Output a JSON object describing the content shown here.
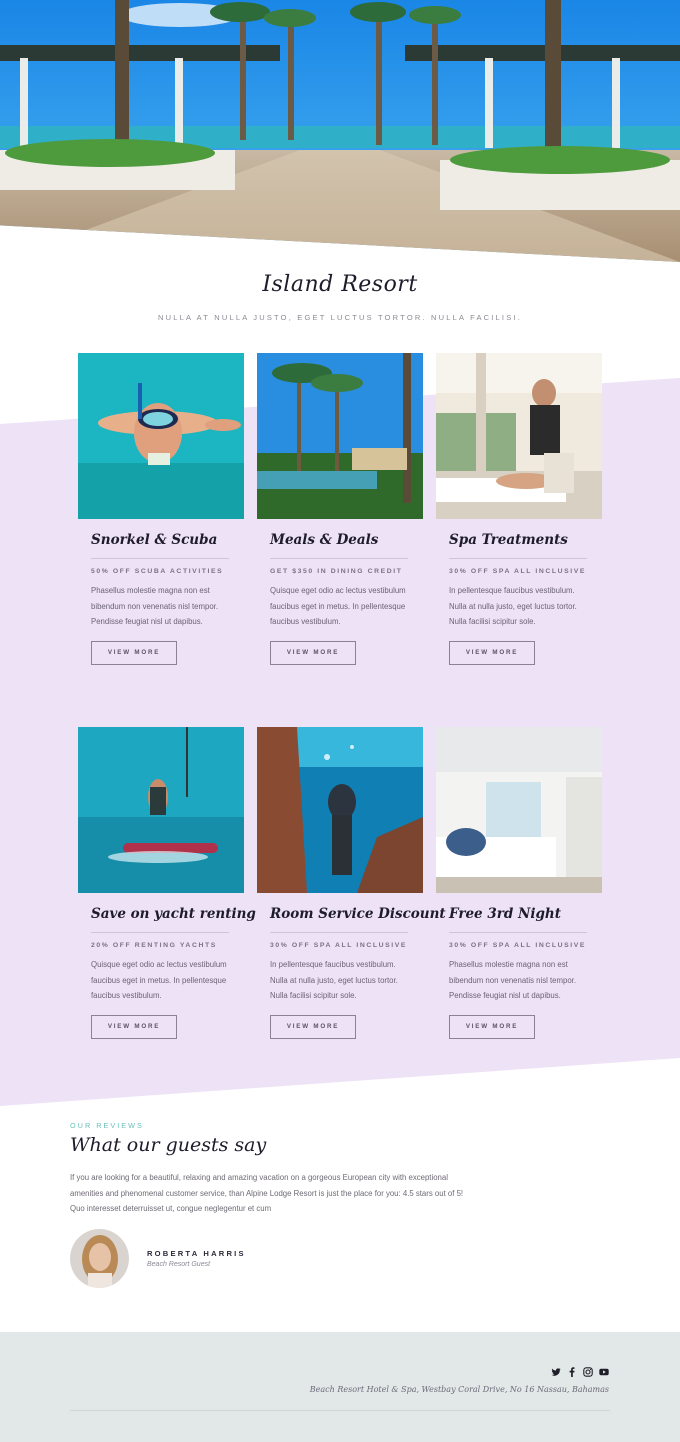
{
  "header": {
    "title": "Island Resort",
    "subtitle": "NULLA AT NULLA JUSTO, EGET LUCTUS TORTOR. NULLA FACILISI."
  },
  "offers": [
    {
      "title": "Snorkel & Scuba",
      "offer": "50% OFF SCUBA ACTIVITIES",
      "text": "Phasellus molestie magna non est bibendum non venenatis nisl tempor. Pendisse feugiat nisl ut dapibus.",
      "button": "VIEW MORE",
      "image": "snorkel-photo"
    },
    {
      "title": "Meals & Deals",
      "offer": "GET $350 IN DINING CREDIT",
      "text": "Quisque eget odio ac lectus vestibulum faucibus eget in metus. In pellentesque faucibus vestibulum.",
      "button": "VIEW MORE",
      "image": "palm-pool-photo"
    },
    {
      "title": "Spa Treatments",
      "offer": "30% OFF SPA ALL INCLUSIVE",
      "text": "In pellentesque faucibus vestibulum. Nulla at nulla justo, eget luctus tortor. Nulla facilisi scipitur sole.",
      "button": "VIEW MORE",
      "image": "spa-massage-photo"
    },
    {
      "title": "Save on yacht renting",
      "offer": "20% OFF RENTING YACHTS",
      "text": "Quisque eget odio ac lectus vestibulum faucibus eget in metus. In pellentesque faucibus vestibulum.",
      "button": "VIEW MORE",
      "image": "kitesurf-photo"
    },
    {
      "title": "Room Service Discount",
      "offer": "30% OFF SPA ALL INCLUSIVE",
      "text": "In pellentesque faucibus vestibulum. Nulla at nulla justo, eget luctus tortor. Nulla facilisi scipitur sole.",
      "button": "VIEW MORE",
      "image": "diver-photo"
    },
    {
      "title": "Free 3rd Night",
      "offer": "30% OFF SPA ALL INCLUSIVE",
      "text": "Phasellus molestie magna non est bibendum non venenatis nisl tempor. Pendisse feugiat nisl ut dapibus.",
      "button": "VIEW MORE",
      "image": "bedroom-photo"
    }
  ],
  "reviews": {
    "kicker": "OUR REVIEWS",
    "title": "What our guests say",
    "text": "If you are looking for a beautiful, relaxing and amazing vacation on a gorgeous European city with exceptional amenities and phenomenal customer service, than Alpine Lodge Resort is just the place for you: 4.5 stars out of 5! Quo interesset deterruisset ut, congue neglegentur et cum",
    "name": "ROBERTA HARRIS",
    "role": "Beach Resort Guest"
  },
  "footer": {
    "social": [
      "twitter-icon",
      "facebook-icon",
      "instagram-icon",
      "youtube-icon"
    ],
    "address": "Beach Resort Hotel & Spa, Westbay Coral Drive, No 16 Nassau, Bahamas"
  },
  "colors": {
    "band": "#ede2f6",
    "accent": "#6cc1bb",
    "footer": "#e2e7e7"
  }
}
